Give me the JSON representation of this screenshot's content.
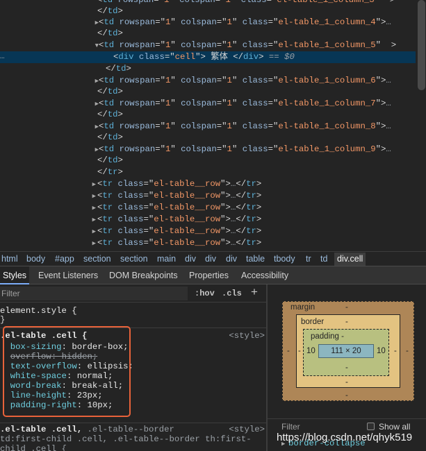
{
  "tree": {
    "line0": {
      "colspan": "1",
      "col": "el-table_1_column_3"
    },
    "line2": {
      "rowspan": "1",
      "colspan": "1",
      "col": "el-table_1_column_4"
    },
    "line4": {
      "rowspan": "1",
      "colspan": "1",
      "col": "el-table_1_column_5"
    },
    "selected": {
      "dots": "…",
      "cls": "cell",
      "text": " 繁体 ",
      "suffix": "== $0"
    },
    "line7": {
      "rowspan": "1",
      "colspan": "1",
      "col": "el-table_1_column_6"
    },
    "line9": {
      "rowspan": "1",
      "colspan": "1",
      "col": "el-table_1_column_7"
    },
    "line11": {
      "rowspan": "1",
      "colspan": "1",
      "col": "el-table_1_column_8"
    },
    "line13": {
      "rowspan": "1",
      "colspan": "1",
      "col": "el-table_1_column_9"
    },
    "row_class": "el-table__row",
    "attr_rowspan": "rowspan",
    "attr_colspan": "colspan",
    "attr_class": "class",
    "tag_td": "td",
    "tag_tr": "tr",
    "tag_div": "div",
    "ellipsis": "…"
  },
  "breadcrumb": [
    "html",
    "body",
    "#app",
    "section",
    "section",
    "main",
    "div",
    "div",
    "div",
    "table",
    "tbody",
    "tr",
    "td",
    "div.cell"
  ],
  "tabs": [
    "Styles",
    "Event Listeners",
    "DOM Breakpoints",
    "Properties",
    "Accessibility"
  ],
  "styles": {
    "filter_placeholder": "Filter",
    "hov": ":hov",
    "cls": ".cls",
    "plus": "+",
    "element_style": "element.style {",
    "close_brace": "}",
    "rule1_selector": ".el-table .cell {",
    "rule1_source": "<style>",
    "rule1_props": [
      {
        "name": "box-sizing",
        "value": "border-box;"
      },
      {
        "name": "overflow",
        "value": "hidden;",
        "struck": true
      },
      {
        "name": "text-overflow",
        "value": "ellipsis;"
      },
      {
        "name": "white-space",
        "value": "normal;"
      },
      {
        "name": "word-break",
        "value": "break-all;"
      },
      {
        "name": "line-height",
        "value": "23px;"
      },
      {
        "name": "padding-right",
        "value": "10px;"
      }
    ],
    "rule2_selector_a": ".el-table .cell,",
    "rule2_selector_b": " .el-table--border",
    "rule2_line2": "td:first-child .cell, .el-table--border th:first-",
    "rule2_line3": "child .cell {",
    "rule2_source": "<style>"
  },
  "box_model": {
    "margin_label": "margin",
    "margin_top": "-",
    "margin_right": "-",
    "margin_bottom": "-",
    "margin_left": "-",
    "border_label": "border",
    "border_top": "-",
    "border_right": "-",
    "border_bottom": "-",
    "border_left": "-",
    "padding_label": "padding -",
    "padding_right": "10",
    "padding_left": "10",
    "padding_bottom": "-",
    "content": "111 × 20"
  },
  "computed": {
    "filter_placeholder": "Filter",
    "show_all": "Show all",
    "first_prop": "border-collapse"
  },
  "watermark": "https://blog.csdn.net/qhyk519",
  "colors": {
    "background": "#242424",
    "selected_row": "#073655",
    "tag": "#5db0d7",
    "attr_value": "#f29766",
    "highlight_box": "#e8623a",
    "margin_box": "#ae8657",
    "border_box": "#e3c381",
    "padding_box": "#b8c080",
    "content_box": "#8cb6c0"
  }
}
